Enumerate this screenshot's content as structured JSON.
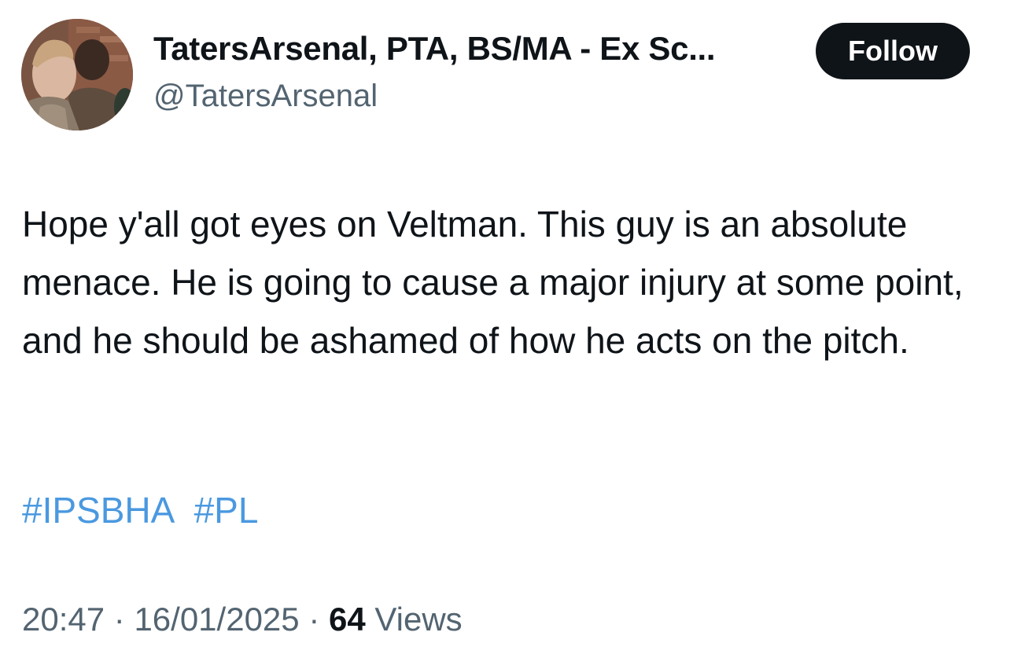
{
  "author": {
    "display_name": "TatersArsenal, PTA, BS/MA - Ex Sc...",
    "handle": "@TatersArsenal"
  },
  "follow_button": {
    "label": "Follow"
  },
  "tweet": {
    "text": "Hope y'all got eyes on Veltman. This guy is an absolute menace. He is going to cause a major injury at some point, and he should be ashamed of how he acts on the pitch.",
    "hashtags": [
      "#IPSBHA",
      "#PL"
    ]
  },
  "meta": {
    "time": "20:47",
    "separator": " · ",
    "date": "16/01/2025",
    "views_count": "64",
    "views_label": " Views"
  },
  "colors": {
    "text": "#0f1419",
    "secondary": "#536471",
    "hashtag": "#4a99e0",
    "button_bg": "#0f1419",
    "button_text": "#ffffff"
  }
}
